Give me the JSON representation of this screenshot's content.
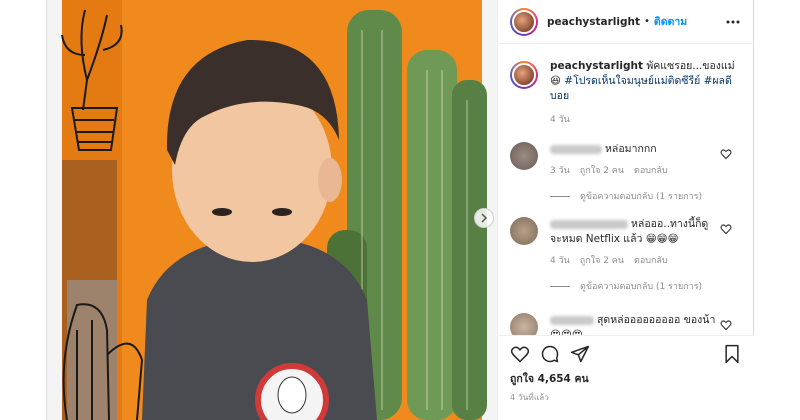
{
  "post": {
    "username": "peachystarlight",
    "dot": "•",
    "follow_label": "ติดตาม",
    "caption": {
      "username": "peachystarlight",
      "text": "พัคแซรอย...ของแม่ 😆",
      "hashtag_1": "#โปรดเห็นใจมนุษย์แม่ติดซีรีย์",
      "hashtag_2": "#ผลดีบอย",
      "time": "4 วัน"
    },
    "comments": [
      {
        "text": "หล่อมากกก",
        "time": "3 วัน",
        "likes": "ถูกใจ 2 คน",
        "reply_label": "ตอบกลับ",
        "view_replies": "ดูข้อความตอบกลับ (1 รายการ)"
      },
      {
        "text": "หล่อออ..ทางนี้ก็ดูจะหมด Netflix แล้ว 😁😁😁",
        "time": "4 วัน",
        "likes": "ถูกใจ 2 คน",
        "reply_label": "ตอบกลับ",
        "view_replies": "ดูข้อความตอบกลับ (1 รายการ)"
      },
      {
        "text": "สุดหล่อออออออออ ของน้า 😍😍😍"
      }
    ],
    "likes_text": "ถูกใจ 4,654 คน",
    "post_time": "4 วันที่แล้ว"
  },
  "colors": {
    "accent_blue": "#0095f6",
    "text_primary": "#262626",
    "text_secondary": "#8e8e8e",
    "hashtag": "#00376b",
    "photo_orange": "#f08a1c"
  },
  "icons": {
    "more": "more-horizontal-icon",
    "like": "heart-icon",
    "comment": "comment-bubble-icon",
    "share": "paper-plane-icon",
    "save": "bookmark-icon",
    "carousel_next": "chevron-right-icon"
  }
}
